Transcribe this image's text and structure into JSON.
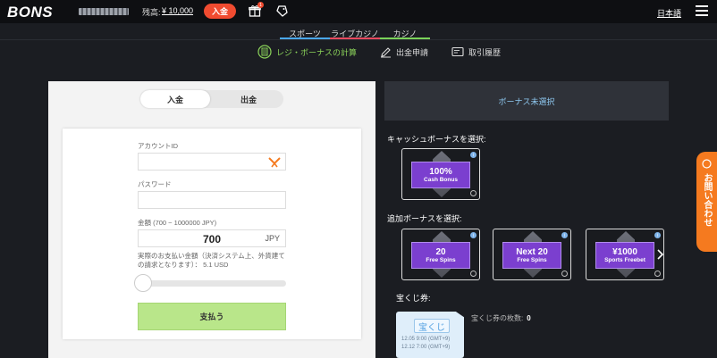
{
  "header": {
    "logo": "BONS",
    "balance_label": "残高:",
    "balance_value": "¥ 10,000",
    "deposit_button": "入金",
    "gift_badge": "1",
    "language": "日本語"
  },
  "nav": {
    "tabs": [
      {
        "label": "スポーツ",
        "color": "#4aa8f0"
      },
      {
        "label": "ライブカジノ",
        "color": "#e84a5f"
      },
      {
        "label": "カジノ",
        "color": "#7bd35a"
      }
    ]
  },
  "subnav": {
    "items": [
      {
        "label": "レジ・ボーナスの計算",
        "active": true
      },
      {
        "label": "出金申請",
        "active": false
      },
      {
        "label": "取引履歴",
        "active": false
      }
    ]
  },
  "payment": {
    "switch": {
      "deposit": "入金",
      "withdraw": "出金"
    },
    "account_label": "アカウントID",
    "password_label": "パスワード",
    "amount_label": "金額 (700 ~ 1000000 JPY)",
    "amount_value": "700",
    "currency": "JPY",
    "note": "実際のお支払い金額（決済システム上、外貨建ての請求となります）： 5.1 USD",
    "pay_button": "支払う",
    "slider_level": 0.0
  },
  "bonus": {
    "header": "ボーナス未選択",
    "cash_title": "キャッシュボーナスを選択:",
    "cash_items": [
      {
        "big": "100%",
        "small": "Cash Bonus"
      }
    ],
    "extra_title": "追加ボーナスを選択:",
    "extra_items": [
      {
        "big": "20",
        "small": "Free Spins"
      },
      {
        "big": "Next 20",
        "small": "Free Spins"
      },
      {
        "big": "¥1000",
        "small": "Sports Freebet"
      }
    ],
    "lottery_label": "宝くじ券:",
    "ticket_title": "宝くじ",
    "ticket_dates": [
      "12.05 9:00 (GMT+9)",
      "12.12 7:00 (GMT+9)"
    ],
    "ticket_count_label": "宝くじ券の枚数:",
    "ticket_count": "0"
  },
  "contact": {
    "label": "お問い合わせ"
  },
  "colors": {
    "accent": "#f04b30",
    "green": "#8bd35a",
    "bonus_purple": "#7b3fcf",
    "contact_orange": "#f57a1f"
  }
}
